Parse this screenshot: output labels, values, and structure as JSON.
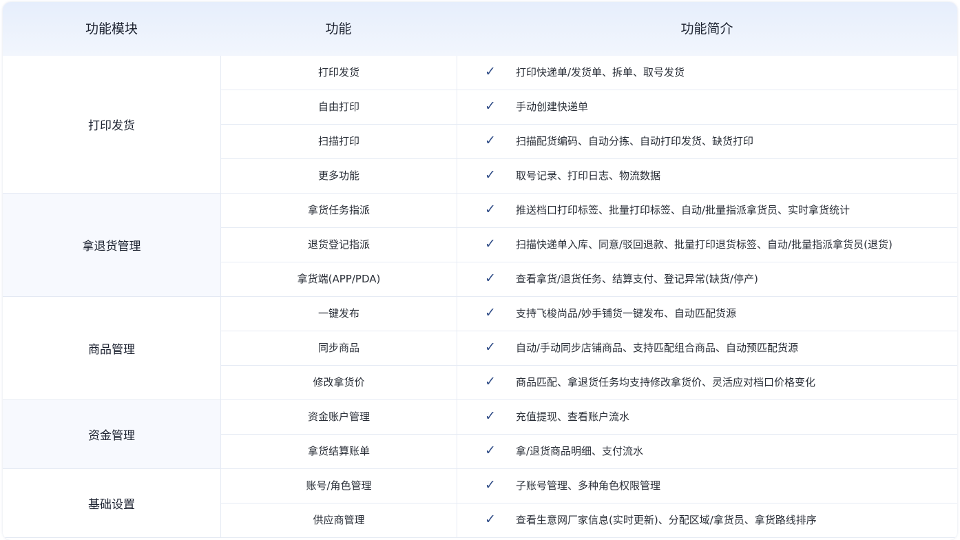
{
  "header": {
    "col_module": "功能模块",
    "col_feature": "功能",
    "col_desc": "功能简介"
  },
  "check_symbol": "✓",
  "groups": [
    {
      "name": "打印发货",
      "rows": [
        {
          "feature": "打印发货",
          "desc": "打印快递单/发货单、拆单、取号发货"
        },
        {
          "feature": "自由打印",
          "desc": "手动创建快递单"
        },
        {
          "feature": "扫描打印",
          "desc": "扫描配货编码、自动分拣、自动打印发货、缺货打印"
        },
        {
          "feature": "更多功能",
          "desc": "取号记录、打印日志、物流数据"
        }
      ]
    },
    {
      "name": "拿退货管理",
      "rows": [
        {
          "feature": "拿货任务指派",
          "desc": "推送档口打印标签、批量打印标签、自动/批量指派拿货员、实时拿货统计"
        },
        {
          "feature": "退货登记指派",
          "desc": "扫描快递单入库、同意/驳回退款、批量打印退货标签、自动/批量指派拿货员(退货)"
        },
        {
          "feature": "拿货端(APP/PDA)",
          "desc": "查看拿货/退货任务、结算支付、登记异常(缺货/停产)"
        }
      ]
    },
    {
      "name": "商品管理",
      "rows": [
        {
          "feature": "一键发布",
          "desc": "支持飞梭尚品/妙手铺货一键发布、自动匹配货源"
        },
        {
          "feature": "同步商品",
          "desc": "自动/手动同步店铺商品、支持匹配组合商品、自动预匹配货源"
        },
        {
          "feature": "修改拿货价",
          "desc": "商品匹配、拿退货任务均支持修改拿货价、灵活应对档口价格变化"
        }
      ]
    },
    {
      "name": "资金管理",
      "rows": [
        {
          "feature": "资金账户管理",
          "desc": "充值提现、查看账户流水"
        },
        {
          "feature": "拿货结算账单",
          "desc": "拿/退货商品明细、支付流水"
        }
      ]
    },
    {
      "name": "基础设置",
      "rows": [
        {
          "feature": "账号/角色管理",
          "desc": "子账号管理、多种角色权限管理"
        },
        {
          "feature": "供应商管理",
          "desc": "查看生意网厂家信息(实时更新)、分配区域/拿货员、拿货路线排序"
        }
      ]
    }
  ]
}
